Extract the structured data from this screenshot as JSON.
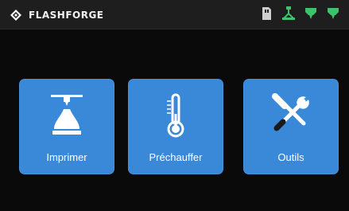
{
  "app": {
    "brand": "FLASHFORGE"
  },
  "status_icons": [
    "sd-card-icon",
    "network-icon",
    "extruder-icon",
    "extruder-icon"
  ],
  "menu": {
    "items": [
      {
        "label": "Imprimer",
        "icon": "print-icon"
      },
      {
        "label": "Préchauffer",
        "icon": "thermometer-icon"
      },
      {
        "label": "Outils",
        "icon": "tools-icon"
      }
    ]
  },
  "colors": {
    "accent": "#3a88d8",
    "status": "#3cc36b",
    "background": "#0a0a0a"
  }
}
